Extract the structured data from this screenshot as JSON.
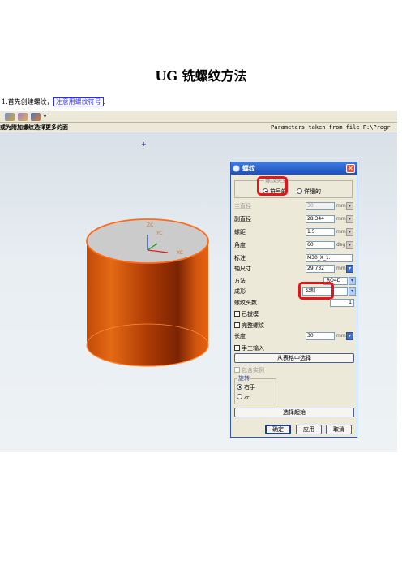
{
  "document": {
    "title": "UG 铣螺纹方法",
    "step_prefix": "1.首先创建螺纹，",
    "step_highlight": "注意用螺纹符号",
    "step_suffix": "."
  },
  "app": {
    "toolbar_icons": [
      "thread-tool-icon",
      "thread-tool-icon",
      "thread-tool-icon"
    ],
    "status_left": "或为附加螺纹选择更多的面",
    "status_right": "Parameters taken from file  F:\\Progr"
  },
  "dialog": {
    "title": "螺纹",
    "type_group_label": "螺纹类型",
    "type_options": [
      "符号的",
      "详细的"
    ],
    "fields": {
      "major_diameter": {
        "label": "主直径",
        "value": "30",
        "unit": "mm"
      },
      "minor_diameter": {
        "label": "副直径",
        "value": "28.344",
        "unit": "mm"
      },
      "pitch": {
        "label": "螺距",
        "value": "1.5",
        "unit": "mm"
      },
      "angle": {
        "label": "角度",
        "value": "60",
        "unit": "deg"
      },
      "callout": {
        "label": "标注",
        "value": "M30_X_1."
      },
      "shaft_size": {
        "label": "轴尺寸",
        "value": "29.732",
        "unit": "mm"
      },
      "method": {
        "label": "方法",
        "value": "RO4D"
      },
      "form": {
        "label": "成形",
        "value": "公制"
      },
      "starts": {
        "label": "螺纹头数",
        "value": "1"
      },
      "length": {
        "label": "长度",
        "value": "30",
        "unit": "mm"
      }
    },
    "tapered_label": "已拔模",
    "full_thread_label": "完整螺纹",
    "manual_input_label": "手工输入",
    "choose_from_table_label": "从表格中选择",
    "include_instances_label": "包含实例",
    "rotation_group_label": "旋转",
    "rotation_options": [
      "右手",
      "左"
    ],
    "select_start_label": "选择起始",
    "ok_label": "确定",
    "apply_label": "应用",
    "cancel_label": "取消"
  },
  "scene": {
    "axis_labels": {
      "zc": "ZC",
      "yc": "YC",
      "xc": "XC"
    },
    "colors": {
      "cylinder": "#e8620e",
      "top_face": "#cbcbcb",
      "highlight": "#e8141c"
    }
  }
}
